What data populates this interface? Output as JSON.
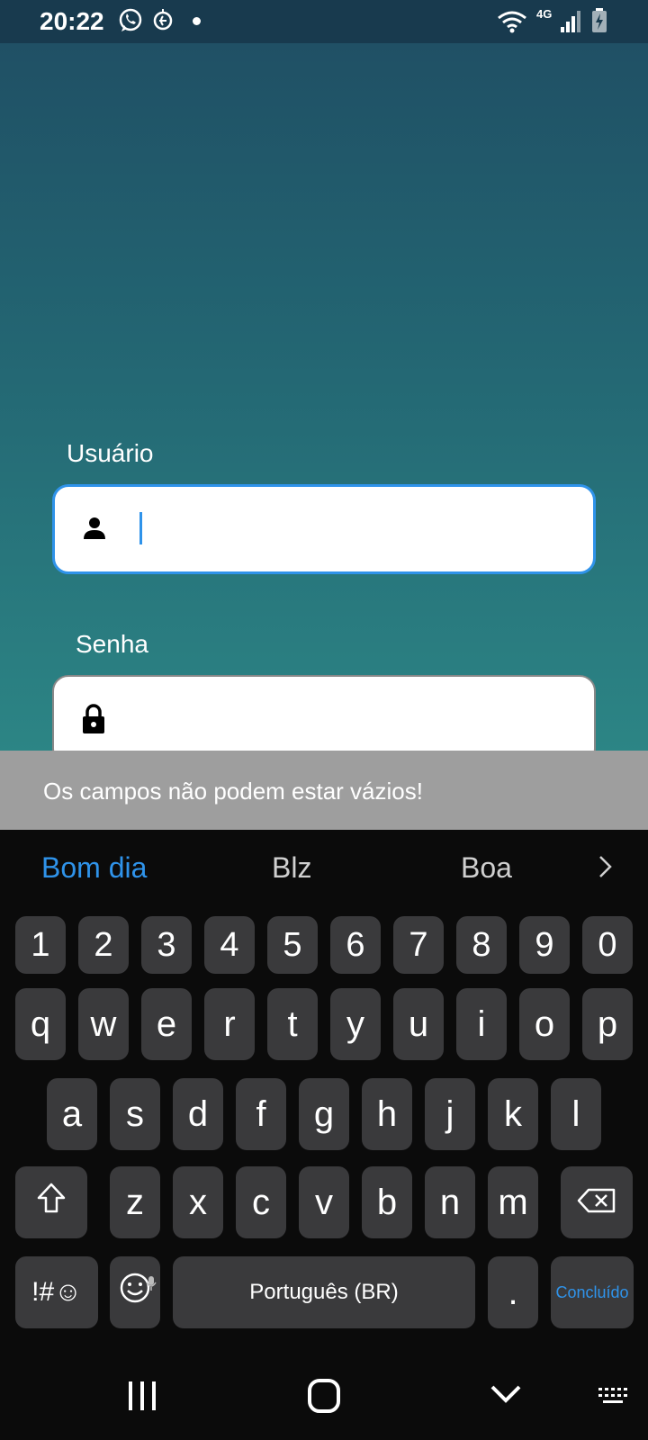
{
  "status_bar": {
    "time": "20:22",
    "network": "4G",
    "icons": [
      "whatsapp-icon",
      "vpn-globe-icon",
      "notification-dot",
      "wifi-icon",
      "signal-icon",
      "battery-charging-icon"
    ]
  },
  "login": {
    "user_label": "Usuário",
    "user_value": "",
    "password_label": "Senha",
    "password_value": "",
    "user_icon": "person-icon",
    "password_icon": "lock-icon"
  },
  "snackbar": {
    "message": "Os campos não podem estar vázios!"
  },
  "keyboard": {
    "suggestions": [
      "Bom dia",
      "Blz",
      "Boa"
    ],
    "number_row": [
      "1",
      "2",
      "3",
      "4",
      "5",
      "6",
      "7",
      "8",
      "9",
      "0"
    ],
    "row1": [
      "q",
      "w",
      "e",
      "r",
      "t",
      "y",
      "u",
      "i",
      "o",
      "p"
    ],
    "row2": [
      "a",
      "s",
      "d",
      "f",
      "g",
      "h",
      "j",
      "k",
      "l"
    ],
    "row3": [
      "z",
      "x",
      "c",
      "v",
      "b",
      "n",
      "m"
    ],
    "symbols_key": "!#☺",
    "space_label": "Português (BR)",
    "period_key": ".",
    "done_label": "Concluído",
    "accent_color": "#2f93ea"
  },
  "navigation": {
    "buttons": [
      "recents-icon",
      "home-icon",
      "hide-keyboard-icon",
      "keyboard-switch-icon"
    ]
  }
}
